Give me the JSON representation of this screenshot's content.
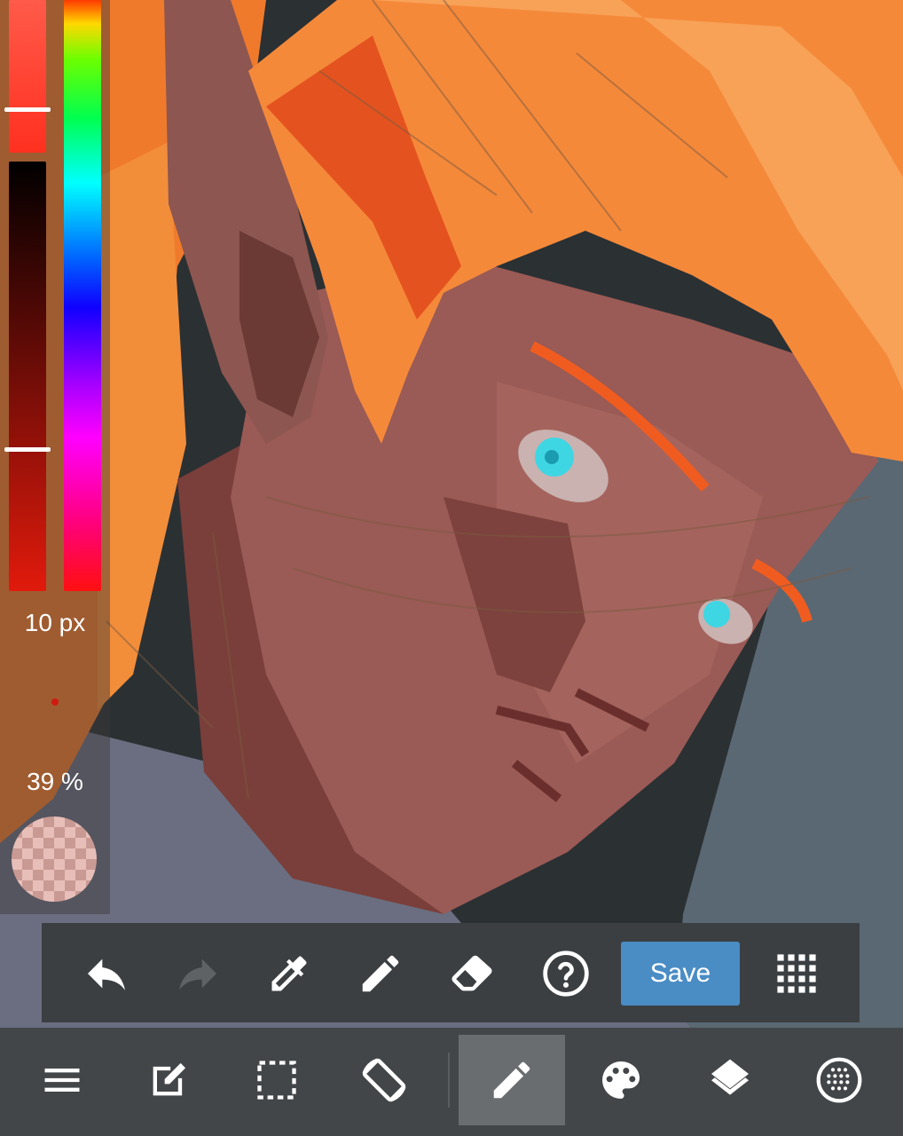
{
  "left_panel": {
    "brush_size": "10 px",
    "brush_opacity": "39 %"
  },
  "quick_toolbar": {
    "save_label": "Save",
    "items": [
      "undo-icon",
      "redo-icon",
      "eyedropper-icon",
      "pencil-icon",
      "eraser-icon",
      "help-icon",
      "save-button",
      "grid-menu-icon"
    ]
  },
  "bottom_nav": {
    "items": [
      "menu-icon",
      "edit-icon",
      "selection-icon",
      "rotate-icon",
      "pen-icon",
      "palette-icon",
      "layers-icon",
      "material-icon"
    ],
    "active": "pen-icon"
  },
  "colors": {
    "accent": "#4a8cc4",
    "current_color": "#e11a0c",
    "toolbar_bg": "#3b3f42",
    "nav_bg": "#434649"
  }
}
